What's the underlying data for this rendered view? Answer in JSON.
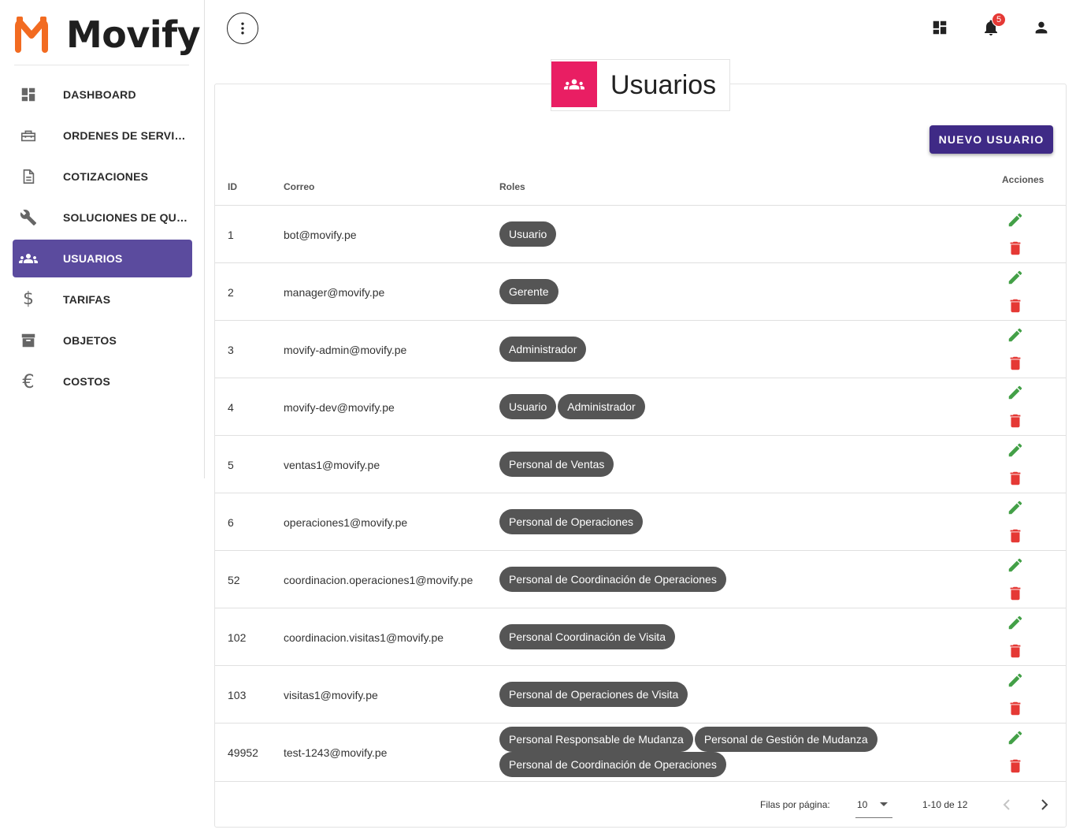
{
  "brand": {
    "name": "Movify"
  },
  "sidebar": {
    "items": [
      {
        "label": "DASHBOARD",
        "icon": "dashboard-icon",
        "active": false
      },
      {
        "label": "ORDENES DE SERVICIO",
        "icon": "toolbox-icon",
        "active": false
      },
      {
        "label": "COTIZACIONES",
        "icon": "document-icon",
        "active": false
      },
      {
        "label": "SOLUCIONES DE QUIE…",
        "icon": "tools-icon",
        "active": false
      },
      {
        "label": "USUARIOS",
        "icon": "users-icon",
        "active": true
      },
      {
        "label": "TARIFAS",
        "icon": "dollar-icon",
        "active": false
      },
      {
        "label": "OBJETOS",
        "icon": "archive-icon",
        "active": false
      },
      {
        "label": "COSTOS",
        "icon": "euro-icon",
        "active": false
      }
    ]
  },
  "topbar": {
    "notifications_count": "5",
    "icons": [
      "more-vertical-icon",
      "dashboard-icon",
      "bell-icon",
      "account-icon"
    ]
  },
  "page": {
    "title": "Usuarios",
    "new_button": "NUEVO USUARIO"
  },
  "table": {
    "columns": {
      "id": "ID",
      "email": "Correo",
      "roles": "Roles",
      "actions": "Acciones"
    },
    "rows": [
      {
        "id": "1",
        "email": "bot@movify.pe",
        "roles": [
          "Usuario"
        ]
      },
      {
        "id": "2",
        "email": "manager@movify.pe",
        "roles": [
          "Gerente"
        ]
      },
      {
        "id": "3",
        "email": "movify-admin@movify.pe",
        "roles": [
          "Administrador"
        ]
      },
      {
        "id": "4",
        "email": "movify-dev@movify.pe",
        "roles": [
          "Usuario",
          "Administrador"
        ]
      },
      {
        "id": "5",
        "email": "ventas1@movify.pe",
        "roles": [
          "Personal de Ventas"
        ]
      },
      {
        "id": "6",
        "email": "operaciones1@movify.pe",
        "roles": [
          "Personal de Operaciones"
        ]
      },
      {
        "id": "52",
        "email": "coordinacion.operaciones1@movify.pe",
        "roles": [
          "Personal de Coordinación de Operaciones"
        ]
      },
      {
        "id": "102",
        "email": "coordinacion.visitas1@movify.pe",
        "roles": [
          "Personal Coordinación de Visita"
        ]
      },
      {
        "id": "103",
        "email": "visitas1@movify.pe",
        "roles": [
          "Personal de Operaciones de Visita"
        ]
      },
      {
        "id": "49952",
        "email": "test-1243@movify.pe",
        "roles": [
          "Personal Responsable de Mudanza",
          "Personal de Gestión de Mudanza",
          "Personal de Coordinación de Operaciones"
        ]
      }
    ]
  },
  "pagination": {
    "rows_per_page_label": "Filas por página:",
    "rows_per_page": "10",
    "range": "1-10 de 12"
  },
  "colors": {
    "brand_orange": "#f26b21",
    "active_nav": "#5b4b9e",
    "primary_button": "#3f2a86",
    "header_icon_bg": "#e91e63",
    "chip_bg": "#555555",
    "edit_green": "#43a047",
    "delete_red": "#e53935",
    "badge_red": "#e53935"
  }
}
